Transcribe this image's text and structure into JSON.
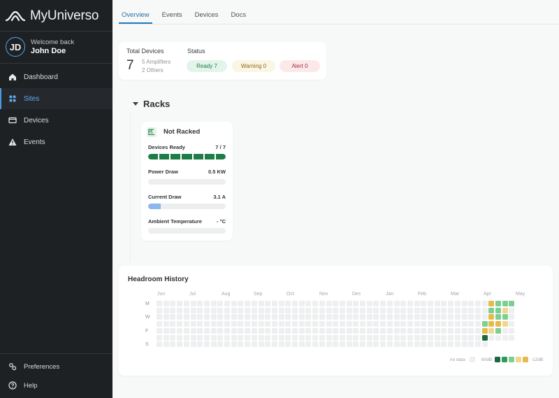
{
  "app": {
    "name": "MyUniverso"
  },
  "user": {
    "initials": "JD",
    "welcome": "Welcome back",
    "name": "John Doe"
  },
  "nav": [
    {
      "label": "Dashboard",
      "icon": "home-icon",
      "active": false
    },
    {
      "label": "Sites",
      "icon": "grid-icon",
      "active": true
    },
    {
      "label": "Devices",
      "icon": "device-icon",
      "active": false
    },
    {
      "label": "Events",
      "icon": "warning-icon",
      "active": false
    }
  ],
  "footer_nav": [
    {
      "label": "Preferences",
      "icon": "gear-icon"
    },
    {
      "label": "Help",
      "icon": "help-icon"
    }
  ],
  "tabs": [
    "Overview",
    "Events",
    "Devices",
    "Docs"
  ],
  "active_tab": "Overview",
  "summary": {
    "total_label": "Total Devices",
    "total_value": "7",
    "amplifiers": "5 Amplifiers",
    "others": "2 Others",
    "status_label": "Status",
    "ready": "Ready 7",
    "warning": "Warning 0",
    "alert": "Alert 0"
  },
  "racks": {
    "title": "Racks",
    "card": {
      "title": "Not Racked",
      "devices_ready_label": "Devices Ready",
      "devices_ready_value": "7 / 7",
      "devices_ready_count": 7,
      "devices_ready_total": 7,
      "power_label": "Power Draw",
      "power_value": "0.5 KW",
      "power_fraction": 0,
      "current_label": "Current Draw",
      "current_value": "3.1 A",
      "current_fraction": 0.16,
      "temp_label": "Ambient Temperature",
      "temp_value": "- °C",
      "temp_fraction": 0
    }
  },
  "headroom": {
    "title": "Headroom History",
    "months": [
      "Jun",
      "Jul",
      "Aug",
      "Sep",
      "Oct",
      "Nov",
      "Dec",
      "Jan",
      "Feb",
      "Mar",
      "Apr",
      "May"
    ],
    "day_labels": [
      "M",
      "W",
      "F",
      "S"
    ],
    "legend": {
      "no_data": "no data",
      "high": "60dB",
      "low": "-12dB"
    },
    "colors": {
      "no_data": "#eeeff0",
      "scale": [
        "#1a6b3c",
        "#2f9b5a",
        "#7ccf91",
        "#f2d68e",
        "#e6bb4c"
      ]
    },
    "active_cells": [
      {
        "week": 49,
        "day": 0,
        "level": 4
      },
      {
        "week": 50,
        "day": 0,
        "level": 2
      },
      {
        "week": 51,
        "day": 0,
        "level": 2
      },
      {
        "week": 52,
        "day": 0,
        "level": 2
      },
      {
        "week": 49,
        "day": 1,
        "level": 2
      },
      {
        "week": 50,
        "day": 1,
        "level": 2
      },
      {
        "week": 51,
        "day": 1,
        "level": 3
      },
      {
        "week": 49,
        "day": 2,
        "level": 4
      },
      {
        "week": 50,
        "day": 2,
        "level": 2
      },
      {
        "week": 51,
        "day": 2,
        "level": 2
      },
      {
        "week": 48,
        "day": 3,
        "level": 2
      },
      {
        "week": 49,
        "day": 3,
        "level": 4
      },
      {
        "week": 50,
        "day": 3,
        "level": 4
      },
      {
        "week": 51,
        "day": 3,
        "level": 3
      },
      {
        "week": 48,
        "day": 4,
        "level": 4
      },
      {
        "week": 49,
        "day": 4,
        "level": 3
      },
      {
        "week": 50,
        "day": 4,
        "level": 2
      },
      {
        "week": 48,
        "day": 5,
        "level": 0
      }
    ]
  }
}
